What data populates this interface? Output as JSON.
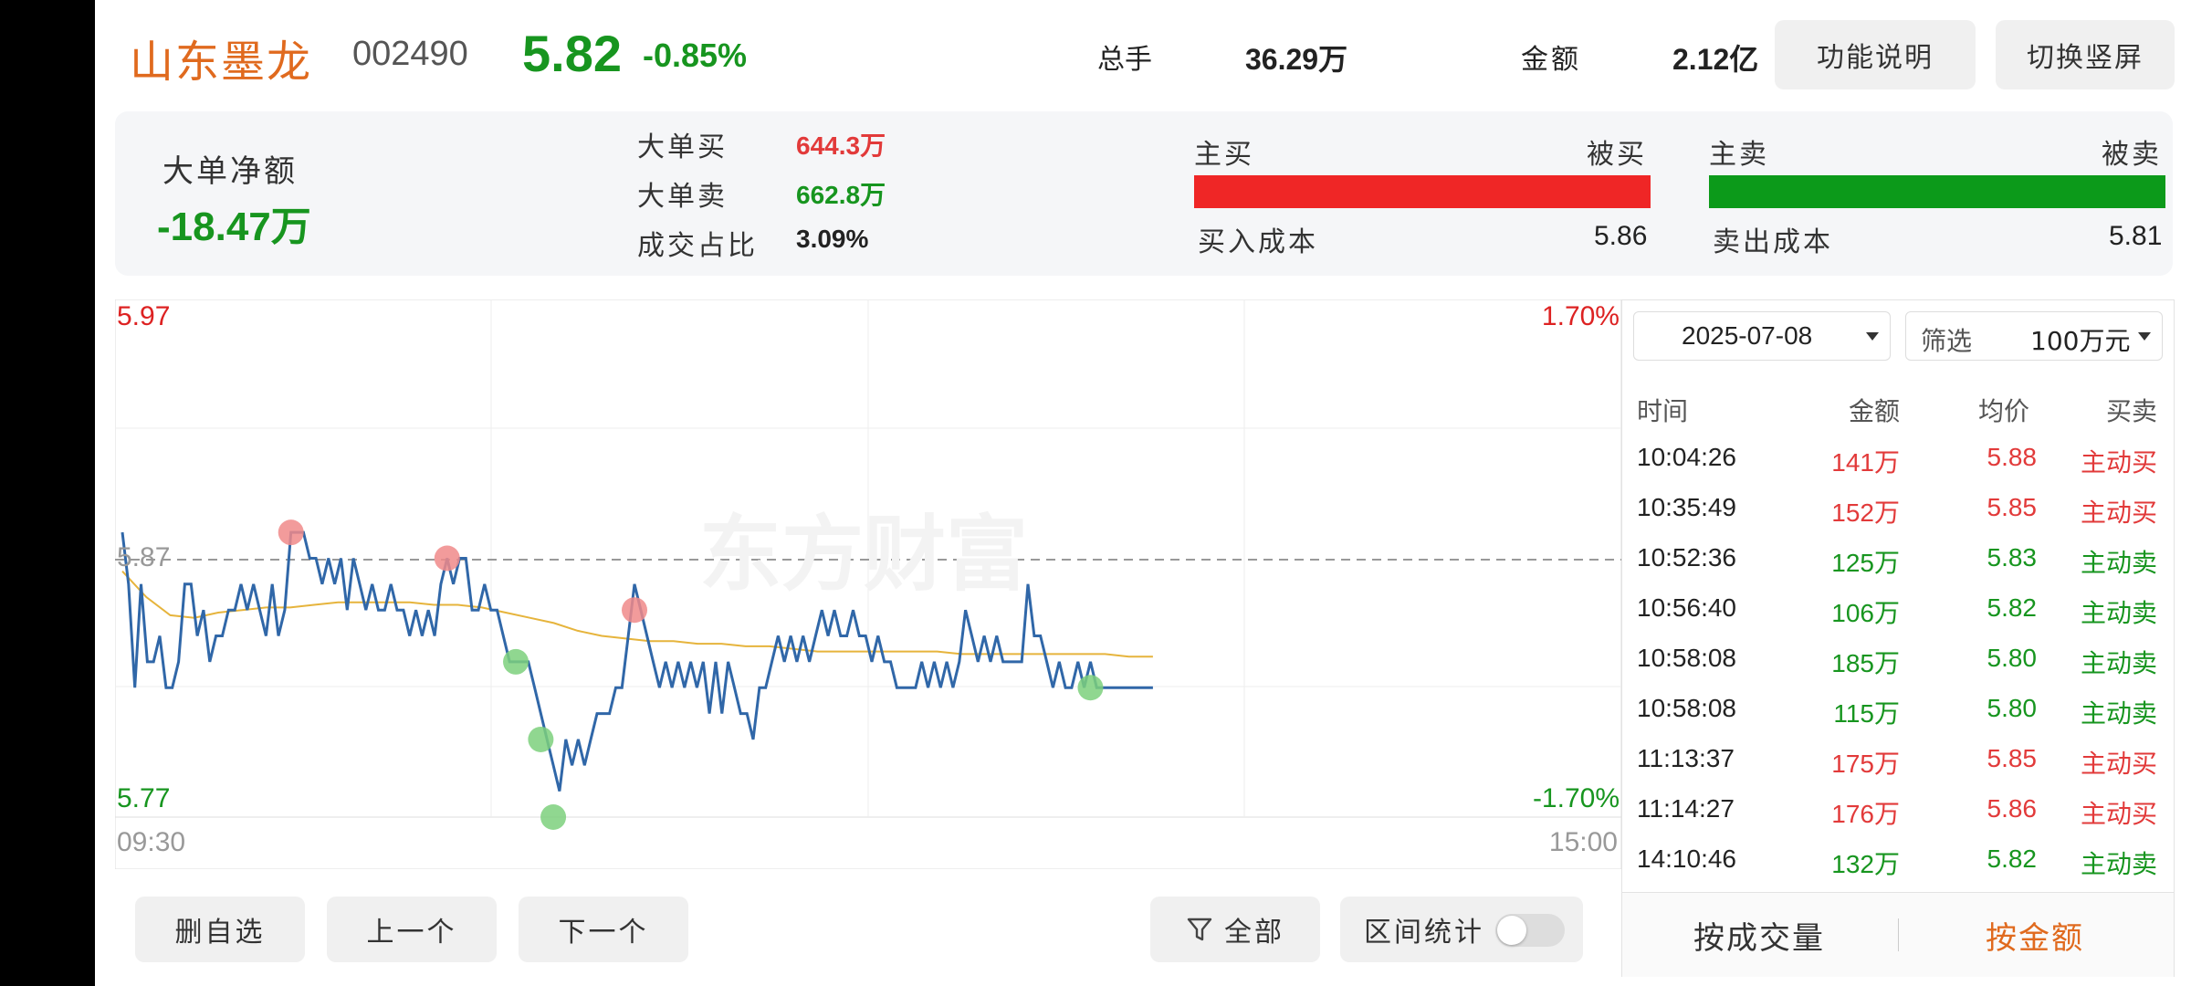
{
  "header": {
    "stock_name": "山东墨龙",
    "stock_code": "002490",
    "price": "5.82",
    "change_pct": "-0.85%",
    "volume_label": "总手",
    "volume_value": "36.29万",
    "amount_label": "金额",
    "amount_value": "2.12亿",
    "help_button": "功能说明",
    "portrait_button": "切换竖屏"
  },
  "summary": {
    "net_label": "大单净额",
    "net_value": "-18.47万",
    "big_buy_label": "大单买",
    "big_buy_value": "644.3万",
    "big_sell_label": "大单卖",
    "big_sell_value": "662.8万",
    "ratio_label": "成交占比",
    "ratio_value": "3.09%",
    "buy_bar": {
      "left_label": "主买",
      "right_label": "被买",
      "cost_label": "买入成本",
      "cost_value": "5.86",
      "ratio": 1.0,
      "color": "#ef2626"
    },
    "sell_bar": {
      "left_label": "主卖",
      "right_label": "被卖",
      "cost_label": "卖出成本",
      "cost_value": "5.81",
      "ratio": 1.0,
      "color": "#0c9a1a"
    }
  },
  "chart": {
    "y_top": "5.97",
    "y_ref": "5.87",
    "y_bottom": "5.77",
    "pct_top": "1.70%",
    "pct_bottom": "-1.70%",
    "time_start": "09:30",
    "time_end": "15:00",
    "watermark": "东方财富"
  },
  "chart_data": {
    "type": "line",
    "y_range": [
      5.77,
      5.97
    ],
    "reference": 5.87,
    "series": [
      {
        "role": "price",
        "color": "#3067a8",
        "values": [
          5.88,
          5.86,
          5.82,
          5.86,
          5.83,
          5.83,
          5.84,
          5.82,
          5.82,
          5.83,
          5.86,
          5.86,
          5.84,
          5.85,
          5.83,
          5.84,
          5.84,
          5.85,
          5.85,
          5.86,
          5.85,
          5.86,
          5.85,
          5.84,
          5.86,
          5.84,
          5.85,
          5.88,
          5.88,
          5.88,
          5.87,
          5.87,
          5.86,
          5.87,
          5.86,
          5.87,
          5.85,
          5.87,
          5.86,
          5.85,
          5.86,
          5.85,
          5.85,
          5.86,
          5.85,
          5.85,
          5.84,
          5.85,
          5.84,
          5.85,
          5.84,
          5.86,
          5.87,
          5.86,
          5.87,
          5.87,
          5.85,
          5.85,
          5.86,
          5.85,
          5.85,
          5.84,
          5.83,
          5.83,
          5.83,
          5.83,
          5.82,
          5.81,
          5.8,
          5.79,
          5.78,
          5.8,
          5.79,
          5.8,
          5.79,
          5.8,
          5.81,
          5.81,
          5.81,
          5.82,
          5.82,
          5.84,
          5.86,
          5.85,
          5.84,
          5.83,
          5.82,
          5.83,
          5.82,
          5.83,
          5.82,
          5.83,
          5.82,
          5.83,
          5.81,
          5.83,
          5.81,
          5.83,
          5.82,
          5.81,
          5.81,
          5.8,
          5.82,
          5.82,
          5.83,
          5.84,
          5.83,
          5.84,
          5.83,
          5.84,
          5.83,
          5.84,
          5.85,
          5.84,
          5.85,
          5.84,
          5.84,
          5.85,
          5.84,
          5.84,
          5.83,
          5.84,
          5.83,
          5.83,
          5.82,
          5.82,
          5.82,
          5.82,
          5.83,
          5.82,
          5.83,
          5.82,
          5.83,
          5.82,
          5.83,
          5.85,
          5.84,
          5.83,
          5.84,
          5.83,
          5.84,
          5.83,
          5.83,
          5.83,
          5.83,
          5.86,
          5.84,
          5.84,
          5.83,
          5.82,
          5.83,
          5.82,
          5.82,
          5.83,
          5.82,
          5.83,
          5.82,
          5.82,
          5.82,
          5.82,
          5.82,
          5.82,
          5.82,
          5.82,
          5.82,
          5.82
        ]
      },
      {
        "role": "average",
        "color": "#e6b43c",
        "values": [
          5.865,
          5.855,
          5.848,
          5.847,
          5.849,
          5.85,
          5.851,
          5.851,
          5.852,
          5.853,
          5.853,
          5.853,
          5.853,
          5.852,
          5.852,
          5.851,
          5.849,
          5.847,
          5.845,
          5.842,
          5.84,
          5.839,
          5.838,
          5.838,
          5.837,
          5.837,
          5.836,
          5.836,
          5.835,
          5.834,
          5.834,
          5.834,
          5.834,
          5.834,
          5.834,
          5.833,
          5.833,
          5.833,
          5.833,
          5.833,
          5.833,
          5.833,
          5.832,
          5.832
        ]
      }
    ],
    "markers": [
      {
        "index": 27,
        "value": 5.88,
        "side": "buy"
      },
      {
        "index": 52,
        "value": 5.87,
        "side": "buy"
      },
      {
        "index": 63,
        "value": 5.83,
        "side": "sell"
      },
      {
        "index": 67,
        "value": 5.8,
        "side": "sell"
      },
      {
        "index": 69,
        "value": 5.77,
        "side": "sell"
      },
      {
        "index": 82,
        "value": 5.85,
        "side": "buy"
      },
      {
        "index": 155,
        "value": 5.82,
        "side": "sell"
      }
    ],
    "total_points": 240,
    "marker_colors": {
      "buy": "#f08a8a",
      "sell": "#7dd07d"
    }
  },
  "filters": {
    "date": "2025-07-08",
    "filter_label": "筛选",
    "filter_value": "100万元"
  },
  "deals": {
    "headers": [
      "时间",
      "金额",
      "均价",
      "买卖"
    ],
    "rows": [
      {
        "time": "10:04:26",
        "amount": "141万",
        "price": "5.88",
        "side": "主动买",
        "buy": true
      },
      {
        "time": "10:35:49",
        "amount": "152万",
        "price": "5.85",
        "side": "主动买",
        "buy": true
      },
      {
        "time": "10:52:36",
        "amount": "125万",
        "price": "5.83",
        "side": "主动卖",
        "buy": false
      },
      {
        "time": "10:56:40",
        "amount": "106万",
        "price": "5.82",
        "side": "主动卖",
        "buy": false
      },
      {
        "time": "10:58:08",
        "amount": "185万",
        "price": "5.80",
        "side": "主动卖",
        "buy": false
      },
      {
        "time": "10:58:08",
        "amount": "115万",
        "price": "5.80",
        "side": "主动卖",
        "buy": false
      },
      {
        "time": "11:13:37",
        "amount": "175万",
        "price": "5.85",
        "side": "主动买",
        "buy": true
      },
      {
        "time": "11:14:27",
        "amount": "176万",
        "price": "5.86",
        "side": "主动买",
        "buy": true
      },
      {
        "time": "14:10:46",
        "amount": "132万",
        "price": "5.82",
        "side": "主动卖",
        "buy": false
      }
    ],
    "tab_volume": "按成交量",
    "tab_amount": "按金额"
  },
  "footer": {
    "remove_watch": "删自选",
    "prev": "上一个",
    "next": "下一个",
    "all_filter": "全部",
    "range_stat": "区间统计",
    "range_stat_on": false
  },
  "colors": {
    "up": "#e23a3a",
    "down": "#17951f",
    "accent": "#e06a1e"
  }
}
